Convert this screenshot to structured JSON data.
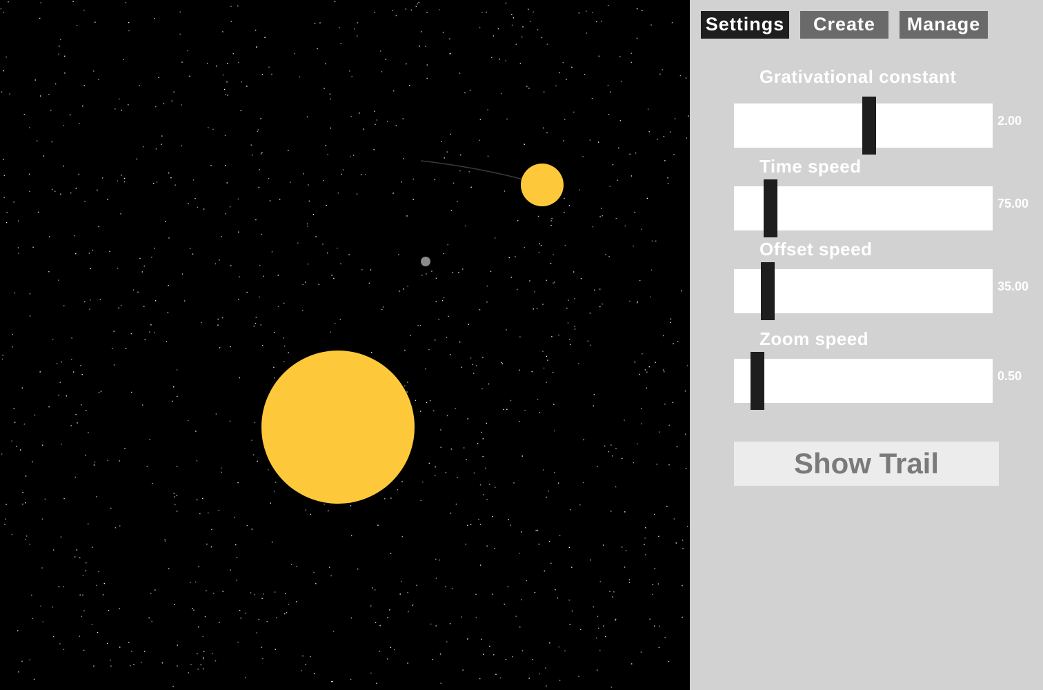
{
  "tabs": [
    {
      "label": "Settings",
      "active": true
    },
    {
      "label": "Create",
      "active": false
    },
    {
      "label": "Manage",
      "active": false
    }
  ],
  "sliders": [
    {
      "label": "Grativational constant",
      "value": "2.00",
      "level": 0.5
    },
    {
      "label": "Time speed",
      "value": "75.00",
      "level": 0.12
    },
    {
      "label": "Offset speed",
      "value": "35.00",
      "level": 0.11
    },
    {
      "label": "Zoom speed",
      "value": "0.50",
      "level": 0.07
    }
  ],
  "show_trail_label": "Show Trail",
  "colors": {
    "space_background": "#000000",
    "panel_background": "#d2d2d2",
    "planet_yellow": "#fdc93a",
    "moon_gray": "#8a8a8a",
    "thumb": "#1e1e1e",
    "tab_active": "#1e1e1e",
    "tab_inactive": "#6a6a6a"
  }
}
